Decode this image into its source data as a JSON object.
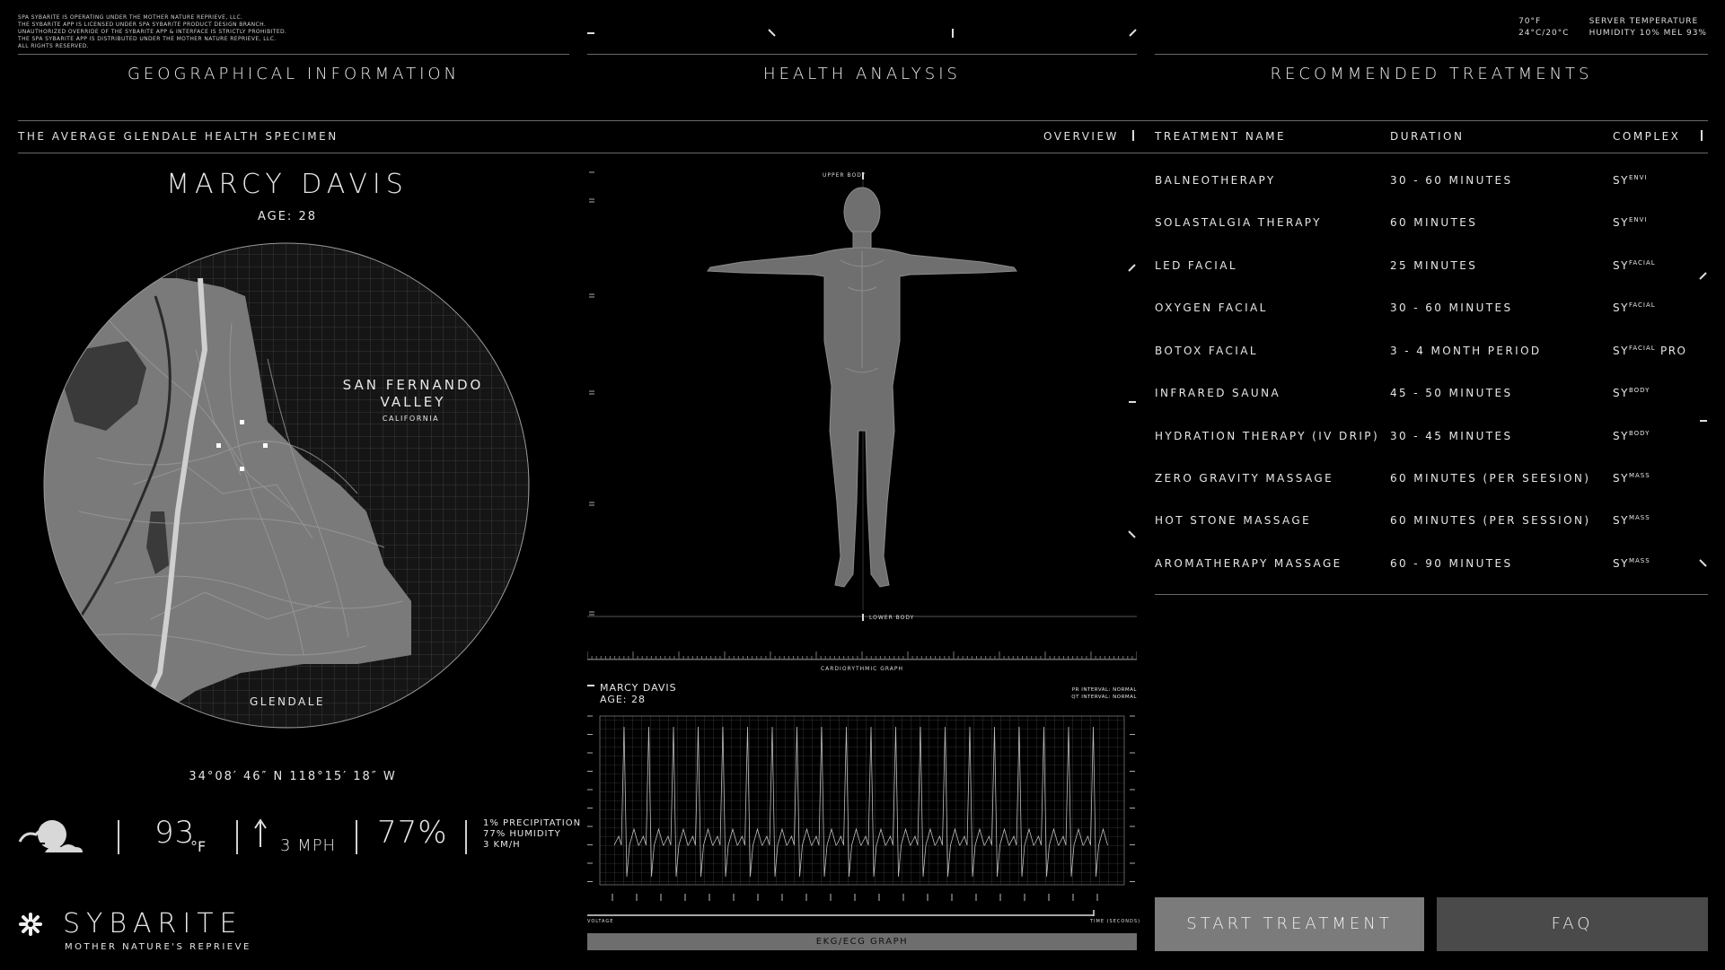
{
  "legal": [
    "SPA SYBARITE IS OPERATING UNDER THE MOTHER NATURE REPRIEVE, LLC.",
    "THE SYBARITE APP IS LICENSED UNDER SPA SYBARITE PRODUCT DESIGN BRANCH.",
    "UNAUTHORIZED OVERRIDE OF THE SYBARITE APP & INTERFACE IS STRICTLY PROHIBITED.",
    "THE SPA SYBARITE APP IS DISTRIBUTED UNDER THE MOTHER NATURE REPRIEVE, LLC.",
    "ALL RIGHTS RESERVED."
  ],
  "server": {
    "temp_f": "70°F",
    "temp_c": "24°C/20°C",
    "label": "SERVER TEMPERATURE",
    "humidity": "HUMIDITY 10% MEL 93%"
  },
  "geo": {
    "title": "GEOGRAPHICAL INFORMATION",
    "subtitle": "THE AVERAGE GLENDALE HEALTH SPECIMEN",
    "name": "MARCY DAVIS",
    "age": "AGE: 28",
    "valley_line1": "SAN FERNANDO",
    "valley_line2": "VALLEY",
    "state": "CALIFORNIA",
    "city": "GLENDALE",
    "coords": "34°08′ 46″ N 118°15′ 18″ W"
  },
  "weather": {
    "icon": "partly-cloudy-icon",
    "temp": "93",
    "temp_unit": "°F",
    "wind": "3 MPH",
    "humidity": "77%",
    "detail1": "1% PRECIPITATION",
    "detail2": "77% HUMIDITY",
    "detail3": "3 KM/H"
  },
  "brand": {
    "name": "SYBARITE",
    "tagline": "MOTHER NATURE'S REPRIEVE"
  },
  "health": {
    "title": "HEALTH ANALYSIS",
    "overview": "OVERVIEW",
    "upper": "UPPER BODY",
    "lower": "LOWER BODY",
    "cardio_title": "CARDIORYTHMIC GRAPH",
    "ecg_name": "MARCY DAVIS",
    "ecg_age": "AGE: 28",
    "pr": "PR INTERVAL: NORMAL",
    "qt": "QT INTERVAL: NORMAL",
    "voltage": "VOLTAGE",
    "time": "TIME (SECONDS)",
    "ecg_label": "EKG/ECG GRAPH"
  },
  "treatments": {
    "title": "RECOMMENDED TREATMENTS",
    "headers": [
      "TREATMENT NAME",
      "DURATION",
      "COMPLEX"
    ],
    "rows": [
      {
        "name": "BALNEOTHERAPY",
        "duration": "30 - 60 MINUTES",
        "sy": "SY",
        "sup": "ENVI",
        "pro": ""
      },
      {
        "name": "SOLASTALGIA THERAPY",
        "duration": "60 MINUTES",
        "sy": "SY",
        "sup": "ENVI",
        "pro": ""
      },
      {
        "name": "LED FACIAL",
        "duration": "25 MINUTES",
        "sy": "SY",
        "sup": "FACIAL",
        "pro": ""
      },
      {
        "name": "OXYGEN FACIAL",
        "duration": "30 - 60 MINUTES",
        "sy": "SY",
        "sup": "FACIAL",
        "pro": ""
      },
      {
        "name": "BOTOX FACIAL",
        "duration": "3 - 4 MONTH PERIOD",
        "sy": "SY",
        "sup": "FACIAL",
        "pro": " PRO"
      },
      {
        "name": "INFRARED SAUNA",
        "duration": "45 - 50 MINUTES",
        "sy": "SY",
        "sup": "BODY",
        "pro": ""
      },
      {
        "name": "HYDRATION THERAPY (IV DRIP)",
        "duration": "30 - 45 MINUTES",
        "sy": "SY",
        "sup": "BODY",
        "pro": ""
      },
      {
        "name": "ZERO GRAVITY MASSAGE",
        "duration": "60 MINUTES (PER SEESION)",
        "sy": "SY",
        "sup": "MASS",
        "pro": ""
      },
      {
        "name": "HOT STONE MASSAGE",
        "duration": "60 MINUTES (PER SESSION)",
        "sy": "SY",
        "sup": "MASS",
        "pro": ""
      },
      {
        "name": "AROMATHERAPY MASSAGE",
        "duration": "60 - 90 MINUTES",
        "sy": "SY",
        "sup": "MASS",
        "pro": ""
      }
    ],
    "start_label": "START TREATMENT",
    "faq_label": "FAQ"
  }
}
